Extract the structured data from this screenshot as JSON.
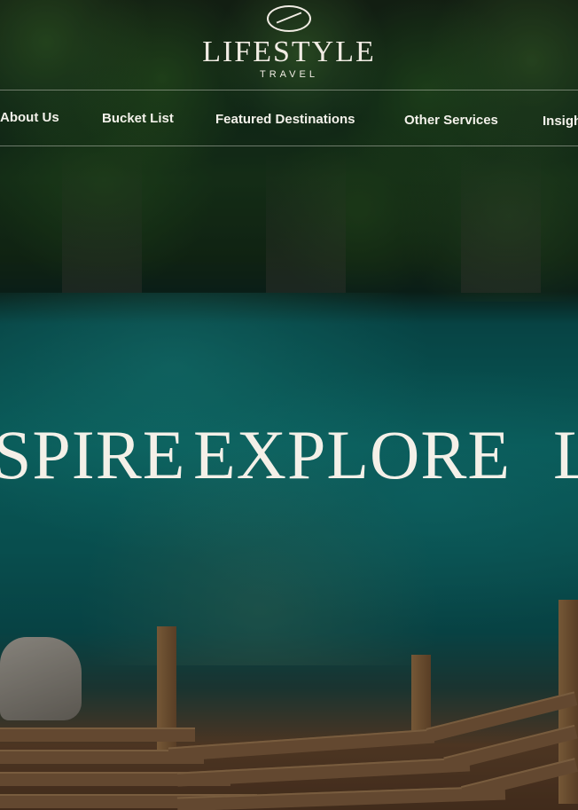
{
  "logo": {
    "title": "LIFESTYLE",
    "subtitle": "TRAVEL"
  },
  "nav": {
    "items": [
      {
        "label": "About Us"
      },
      {
        "label": "Bucket List"
      },
      {
        "label": "Featured Destinations"
      },
      {
        "label": "Other Services"
      },
      {
        "label": "Insigh"
      }
    ]
  },
  "hero": {
    "tagline_words": [
      "SPIRE",
      "EXPLORE",
      "L"
    ]
  },
  "colors": {
    "text": "#f1ece4",
    "water": "#0d7c7a",
    "jungle": "#1c3e1f",
    "dock": "#8a6543"
  }
}
